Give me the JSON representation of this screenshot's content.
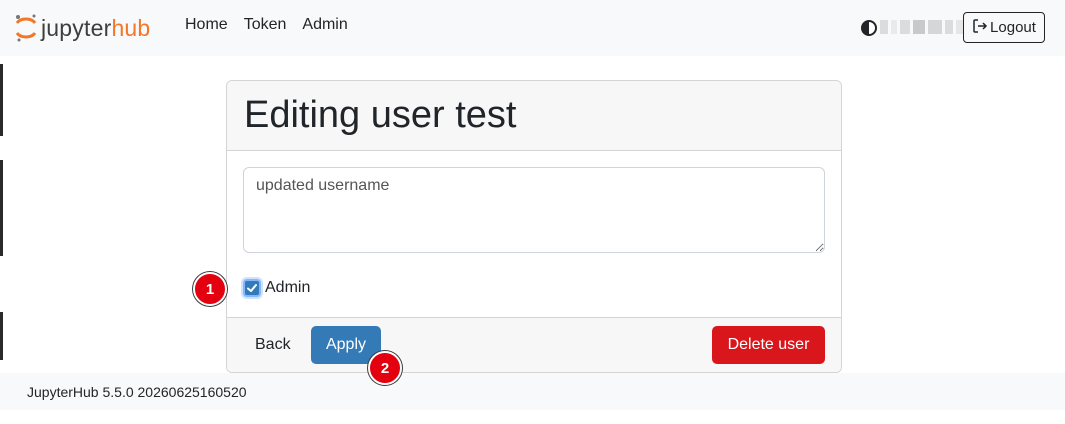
{
  "navbar": {
    "brand": {
      "part1": "jupyter",
      "part2": "hub"
    },
    "links": [
      "Home",
      "Token",
      "Admin"
    ],
    "logout_label": "Logout"
  },
  "card": {
    "title": "Editing user test",
    "username_placeholder": "updated username",
    "admin_label": "Admin",
    "admin_checked": true,
    "back_label": "Back",
    "apply_label": "Apply",
    "delete_label": "Delete user"
  },
  "footer": {
    "version": "JupyterHub 5.5.0 20260625160520"
  },
  "markers": [
    "1",
    "2"
  ],
  "colors": {
    "accent": "#337ab7",
    "danger": "#d9161c",
    "brand_orange": "#f37726",
    "marker": "#e3000f"
  },
  "icons": {
    "logo": "jupyter-logo-icon",
    "theme": "half-circle-contrast-icon",
    "logout": "logout-arrow-icon",
    "check": "checkmark-icon"
  }
}
